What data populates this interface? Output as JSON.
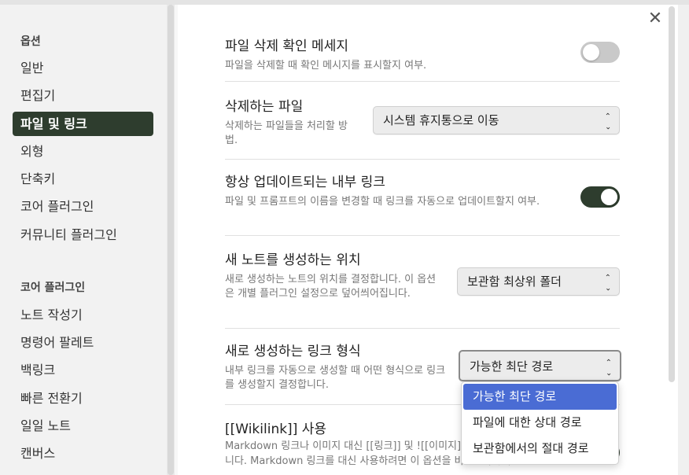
{
  "sidebar": {
    "section1_title": "옵션",
    "items1": [
      {
        "label": "일반"
      },
      {
        "label": "편집기"
      },
      {
        "label": "파일 및 링크"
      },
      {
        "label": "외형"
      },
      {
        "label": "단축키"
      },
      {
        "label": "코어 플러그인"
      },
      {
        "label": "커뮤니티 플러그인"
      }
    ],
    "section2_title": "코어 플러그인",
    "items2": [
      {
        "label": "노트 작성기"
      },
      {
        "label": "명령어 팔레트"
      },
      {
        "label": "백링크"
      },
      {
        "label": "빠른 전환기"
      },
      {
        "label": "일일 노트"
      },
      {
        "label": "캔버스"
      }
    ]
  },
  "close_icon": "close-icon",
  "settings": {
    "confirm_delete": {
      "title": "파일 삭제 확인 메세지",
      "desc": "파일을 삭제할 때 확인 메시지를 표시할지 여부.",
      "enabled": false
    },
    "deleted_files": {
      "title": "삭제하는 파일",
      "desc": "삭제하는 파일들을 처리할 방법.",
      "value": "시스템 휴지통으로 이동"
    },
    "auto_update_links": {
      "title": "항상 업데이트되는 내부 링크",
      "desc": "파일 및 프롬프트의 이름을 변경할 때 링크를 자동으로 업데이트할지 여부.",
      "enabled": true
    },
    "new_note_location": {
      "title": "새 노트를 생성하는 위치",
      "desc": "새로 생성하는 노트의 위치를 결정합니다. 이 옵션은 개별 플러그인 설정으로 덮어씌어집니다.",
      "value": "보관함 최상위 폴더"
    },
    "new_link_format": {
      "title": "새로 생성하는 링크 형식",
      "desc": "내부 링크를 자동으로 생성할 때 어떤 형식으로 링크를 생성할지 결정합니다.",
      "value": "가능한 최단 경로",
      "options": [
        "가능한 최단 경로",
        "파일에 대한 상대 경로",
        "보관함에서의 절대 경로"
      ]
    },
    "wikilink": {
      "title": "[[Wikilink]] 사용",
      "desc": "Markdown 링크나 이미지 대신 [[링크]] 및 ![[이미지]]를 자동으로 생성합니다. Markdown 링크를 대신 사용하려면 이 옵션을 비활성화하세요."
    }
  },
  "colors": {
    "accent": "#2e3d2e",
    "dropdown_selected": "#4a6cd4"
  }
}
